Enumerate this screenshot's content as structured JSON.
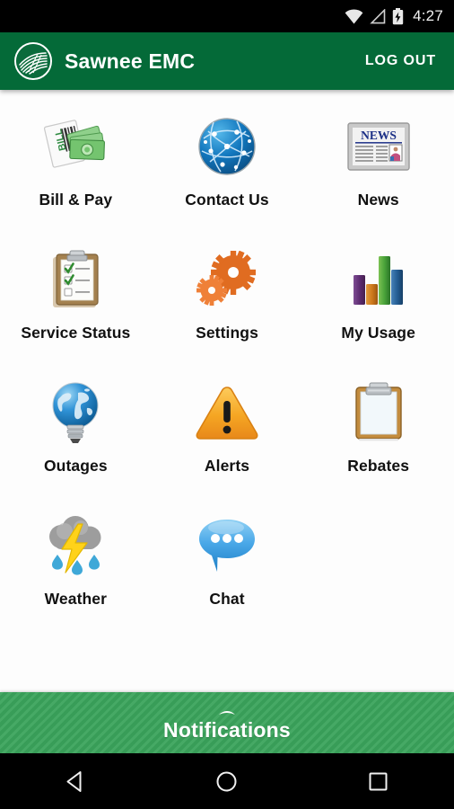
{
  "status_bar": {
    "wifi_icon": "wifi-icon",
    "signal_icon": "signal-icon",
    "battery_icon": "battery-charging-icon",
    "time": "4:27"
  },
  "app_bar": {
    "logo_icon": "sawnee-emc-logo-icon",
    "title": "Sawnee EMC",
    "logout_label": "LOG OUT",
    "background_color": "#046A38"
  },
  "menu": {
    "tiles": [
      {
        "label": "Bill & Pay",
        "icon": "bill-and-money-icon"
      },
      {
        "label": "Contact Us",
        "icon": "globe-network-icon"
      },
      {
        "label": "News",
        "icon": "newspaper-icon"
      },
      {
        "label": "Service Status",
        "icon": "clipboard-checklist-icon"
      },
      {
        "label": "Settings",
        "icon": "gears-icon"
      },
      {
        "label": "My Usage",
        "icon": "bar-chart-icon"
      },
      {
        "label": "Outages",
        "icon": "globe-lightbulb-icon"
      },
      {
        "label": "Alerts",
        "icon": "warning-triangle-icon"
      },
      {
        "label": "Rebates",
        "icon": "clipboard-blank-icon"
      },
      {
        "label": "Weather",
        "icon": "storm-cloud-icon"
      },
      {
        "label": "Chat",
        "icon": "speech-bubble-icon"
      }
    ]
  },
  "notifications": {
    "label": "Notifications",
    "expand_icon": "chevron-up-icon",
    "background_color": "#3BA45C"
  },
  "nav_bar": {
    "back_icon": "back-triangle-icon",
    "home_icon": "home-circle-icon",
    "recents_icon": "recents-square-icon"
  },
  "news_icon_text": "NEWS"
}
